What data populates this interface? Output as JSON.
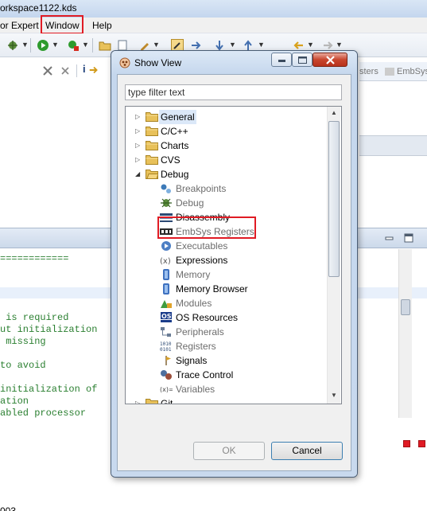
{
  "window": {
    "title": "orkspace1122.kds"
  },
  "menubar": {
    "items": [
      "or Expert",
      "Window",
      "Help"
    ]
  },
  "right_tabs": [
    "sters",
    "EmbSys"
  ],
  "console": {
    "lines": [
      "============",
      "",
      "",
      "",
      "",
      " is required",
      "ut initialization",
      " missing",
      "",
      "to avoid",
      "",
      "initialization of",
      "ation",
      "abled processor"
    ]
  },
  "bottom_text": "003",
  "dialog": {
    "title": "Show View",
    "filter_placeholder": "type filter text",
    "tree": [
      {
        "label": "General",
        "type": "folder",
        "expanded": false,
        "selected": true
      },
      {
        "label": "C/C++",
        "type": "folder",
        "expanded": false
      },
      {
        "label": "Charts",
        "type": "folder",
        "expanded": false
      },
      {
        "label": "CVS",
        "type": "folder",
        "expanded": false
      },
      {
        "label": "Debug",
        "type": "folder",
        "expanded": true
      },
      {
        "label": "Breakpoints",
        "type": "view",
        "icon": "breakpoints-icon",
        "enabled": false
      },
      {
        "label": "Debug",
        "type": "view",
        "icon": "debug-icon",
        "enabled": false
      },
      {
        "label": "Disassembly",
        "type": "view",
        "icon": "disassembly-icon",
        "enabled": true
      },
      {
        "label": "EmbSys Registers",
        "type": "view",
        "icon": "embsys-registers-icon",
        "enabled": false
      },
      {
        "label": "Executables",
        "type": "view",
        "icon": "executables-icon",
        "enabled": false
      },
      {
        "label": "Expressions",
        "type": "view",
        "icon": "expressions-icon",
        "enabled": true
      },
      {
        "label": "Memory",
        "type": "view",
        "icon": "memory-icon",
        "enabled": false
      },
      {
        "label": "Memory Browser",
        "type": "view",
        "icon": "memory-browser-icon",
        "enabled": true
      },
      {
        "label": "Modules",
        "type": "view",
        "icon": "modules-icon",
        "enabled": false
      },
      {
        "label": "OS Resources",
        "type": "view",
        "icon": "os-resources-icon",
        "enabled": true
      },
      {
        "label": "Peripherals",
        "type": "view",
        "icon": "peripherals-icon",
        "enabled": false
      },
      {
        "label": "Registers",
        "type": "view",
        "icon": "registers-icon",
        "enabled": false
      },
      {
        "label": "Signals",
        "type": "view",
        "icon": "signals-icon",
        "enabled": true
      },
      {
        "label": "Trace Control",
        "type": "view",
        "icon": "trace-control-icon",
        "enabled": true
      },
      {
        "label": "Variables",
        "type": "view",
        "icon": "variables-icon",
        "enabled": false
      },
      {
        "label": "Git",
        "type": "folder",
        "expanded": false
      }
    ],
    "ok_label": "OK",
    "cancel_label": "Cancel"
  },
  "colors": {
    "highlight_red": "#e01b24",
    "folder_yellow": "#e8c15a",
    "code_green": "#2a7f30"
  }
}
